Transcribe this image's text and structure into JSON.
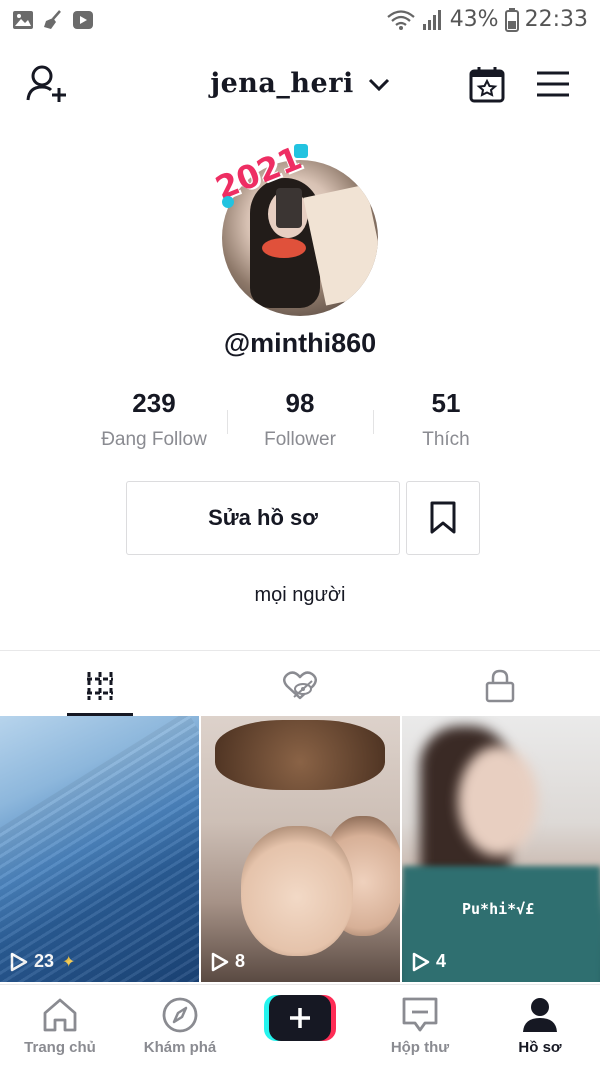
{
  "status_bar": {
    "battery": "43%",
    "time": "22:33",
    "icons": [
      "gallery-icon",
      "broom-icon",
      "video-icon",
      "wifi-icon",
      "signal-icon",
      "battery-icon"
    ]
  },
  "header": {
    "title": "jena_heri",
    "icons": [
      "add-user-icon",
      "chevron-down-icon",
      "calendar-star-icon",
      "menu-icon"
    ]
  },
  "profile": {
    "avatar_sticker": "2021",
    "username": "@minthi860",
    "bio": "mọi người"
  },
  "stats": [
    {
      "value": "239",
      "label": "Đang Follow"
    },
    {
      "value": "98",
      "label": "Follower"
    },
    {
      "value": "51",
      "label": "Thích"
    }
  ],
  "actions": {
    "edit_label": "Sửa hồ sơ",
    "bookmark_icon": "bookmark-icon"
  },
  "tabs": [
    {
      "icon": "grid-icon",
      "active": true
    },
    {
      "icon": "liked-hidden-icon",
      "active": false
    },
    {
      "icon": "lock-icon",
      "active": false
    }
  ],
  "videos": [
    {
      "views": "23"
    },
    {
      "views": "8"
    },
    {
      "views": "4",
      "caption": "Pu*hi*√£"
    }
  ],
  "bottom_nav": {
    "items": [
      {
        "label": "Trang chủ",
        "icon": "home-icon"
      },
      {
        "label": "Khám phá",
        "icon": "compass-icon"
      },
      {
        "label": "",
        "icon": "plus-icon"
      },
      {
        "label": "Hộp thư",
        "icon": "inbox-icon"
      },
      {
        "label": "Hồ sơ",
        "icon": "profile-icon"
      }
    ]
  },
  "colors": {
    "text": "#161823",
    "muted": "#8a8b91",
    "accent_pink": "#fe2c55",
    "accent_cyan": "#25f4ee"
  }
}
